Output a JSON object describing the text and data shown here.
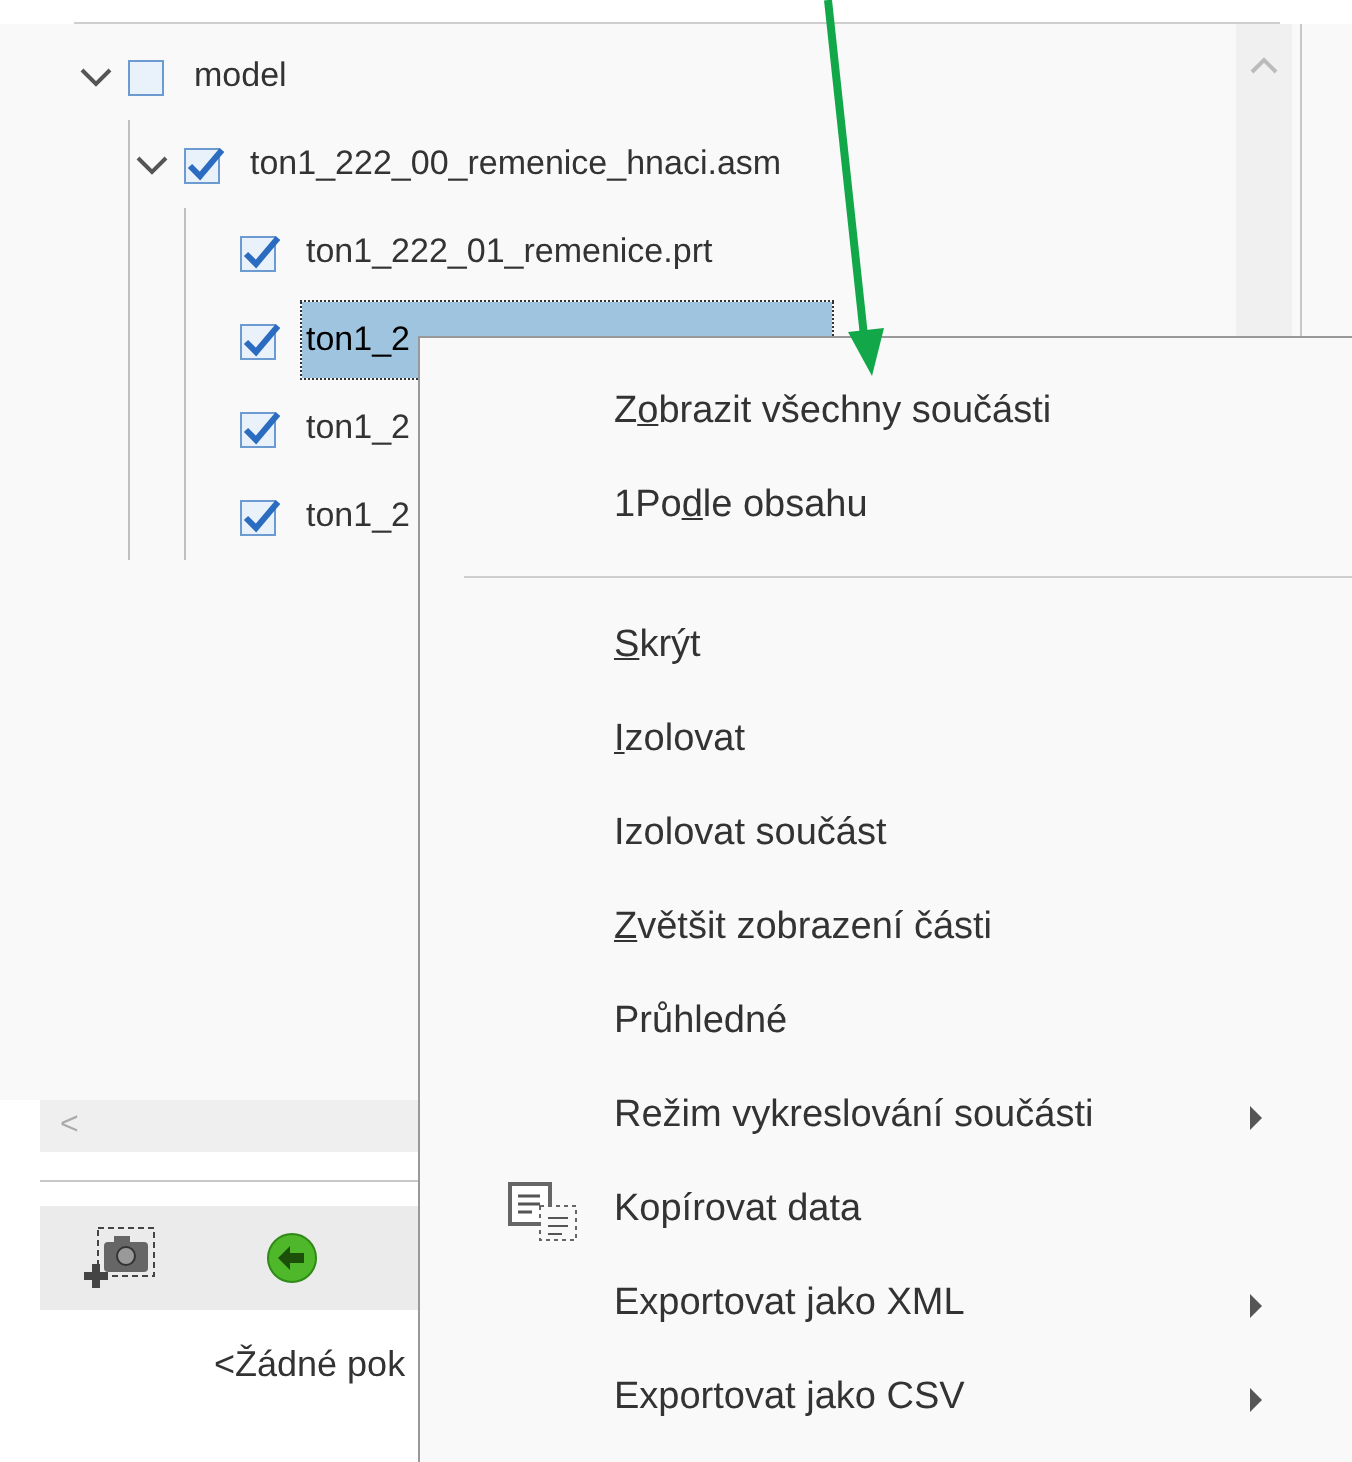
{
  "tree": [
    {
      "label": "model",
      "checked": false,
      "expanded": true,
      "selected": false,
      "children": [
        {
          "label": "ton1_222_00_remenice_hnaci.asm",
          "checked": true,
          "expanded": true,
          "selected": false,
          "children": [
            {
              "label": "ton1_222_01_remenice.prt",
              "checked": true,
              "selected": false
            },
            {
              "label": "ton1_2",
              "checked": true,
              "selected": true
            },
            {
              "label": "ton1_2",
              "checked": true,
              "selected": false
            },
            {
              "label": "ton1_2",
              "checked": true,
              "selected": false
            }
          ]
        }
      ]
    }
  ],
  "scroll_left": "<",
  "status_text": "<Žádné pok",
  "context_menu": [
    {
      "kind": "command",
      "parts": {
        "before": "Z",
        "key": "o",
        "after": "brazit všechny součásti"
      }
    },
    {
      "kind": "command",
      "parts": {
        "before": "1Po",
        "key": "d",
        "after": "le obsahu"
      }
    },
    {
      "kind": "separator"
    },
    {
      "kind": "command",
      "parts": {
        "key": "S",
        "after": "krýt"
      }
    },
    {
      "kind": "command",
      "parts": {
        "key": "I",
        "after": "zolovat"
      }
    },
    {
      "kind": "command",
      "label": "Izolovat součást"
    },
    {
      "kind": "command",
      "parts": {
        "key": "Z",
        "after": "většit zobrazení části"
      }
    },
    {
      "kind": "command",
      "label": "Průhledné"
    },
    {
      "kind": "submenu",
      "label": "Režim vykreslování součásti"
    },
    {
      "kind": "icon_command",
      "label": "Kopírovat data"
    },
    {
      "kind": "submenu",
      "label": "Exportovat jako XML"
    },
    {
      "kind": "submenu",
      "label": "Exportovat jako CSV"
    }
  ]
}
